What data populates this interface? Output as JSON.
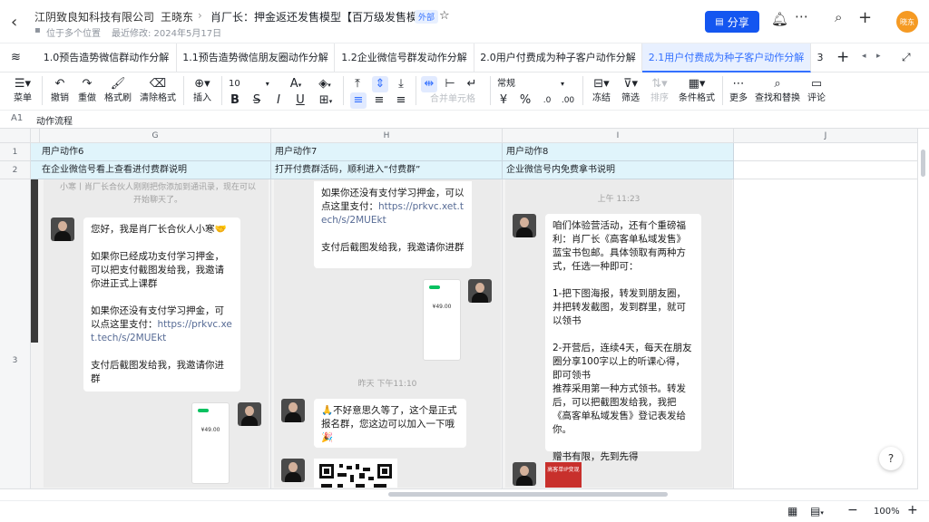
{
  "header": {
    "company": "江阴致良知科技有限公司",
    "owner": "王晓东",
    "doc_title": "肖厂长：押金返还发售模型【百万级发售模型】",
    "external_badge": "外部",
    "location": "位于多个位置",
    "modified": "最近修改: 2024年5月17日",
    "share_label": "分享",
    "avatar_text": "晓东"
  },
  "tabs": [
    {
      "label": "1.0预告造势微信群动作分解"
    },
    {
      "label": "1.1预告造势微信朋友圈动作分解"
    },
    {
      "label": "1.2企业微信号群发动作分解"
    },
    {
      "label": "2.0用户付费成为种子客户动作分解"
    },
    {
      "label": "2.1用户付费成为种子客户动作分解"
    },
    {
      "label": "3"
    }
  ],
  "toolbar": {
    "menu": "菜单",
    "undo": "撤销",
    "redo": "重做",
    "painter": "格式刷",
    "clear": "清除格式",
    "insert": "插入",
    "font_size": "10",
    "merge": "合并单元格",
    "number_format": "常规",
    "freeze": "冻结",
    "filter": "筛选",
    "sort": "排序",
    "cond": "条件格式",
    "more": "更多",
    "find": "查找和替换",
    "comment": "评论"
  },
  "formula": {
    "cell_ref": "A1",
    "content": "动作流程"
  },
  "columns": [
    "G",
    "H",
    "I",
    "J"
  ],
  "rows": [
    "1",
    "2",
    "3"
  ],
  "row1": [
    "用户动作6",
    "用户动作7",
    "用户动作8"
  ],
  "row2": [
    "在企业微信号看上查看进付费群说明",
    "打开付费群活码，顺利进入“付费群”",
    "企业微信号内免费拿书说明"
  ],
  "chatG": {
    "top_note": "小寒丨肖厂长合伙人刚刚把你添加到通讯录，现在可以开始聊天了。",
    "msg": "您好，我是肖厂长合伙人小寒🤝\n\n如果你已经成功支付学习押金，可以把支付截图发给我，我邀请你进正式上课群\n\n如果你还没有支付学习押金，可以点这里支付：",
    "link": "https://prkvc.xet.tech/s/2MUEkt",
    "msg_end": "支付后截图发给我，我邀请你进群",
    "pay_amount": "¥49.00"
  },
  "chatH": {
    "msg": "如果你还没有支付学习押金，可以点这里支付：",
    "link": "https://prkvc.xet.tech/s/2MUEkt",
    "msg_end": "支付后截图发给我，我邀请你进群",
    "pay_amount": "¥49.00",
    "time": "昨天 下午11:10",
    "msg2": "🙏不好意思久等了，这个是正式报名群，您这边可以加入一下哦🎉"
  },
  "chatI": {
    "time": "上午 11:23",
    "msg": "咱们体验营活动，还有个重磅福利：肖厂长《高客单私域发售》蓝宝书包邮。具体领取有两种方式，任选一种即可：\n\n1-把下图海报，转发到朋友圈，并把转发截图，发到群里，就可以领书\n\n2-开营后，连续4天，每天在朋友圈分享100字以上的听课心得，即可领书\n推荐采用第一种方式领书。转发后，可以把截图发给我，我把《高客单私域发售》登记表发给你。\n\n赠书有限，先到先得",
    "poster_title": "高客单IP变现"
  },
  "status": {
    "zoom": "100%"
  },
  "colors": {
    "accent": "#3370ff",
    "cell_fill": "#e0f4fb",
    "chat_bg": "#ebebeb",
    "link": "#576b95"
  }
}
